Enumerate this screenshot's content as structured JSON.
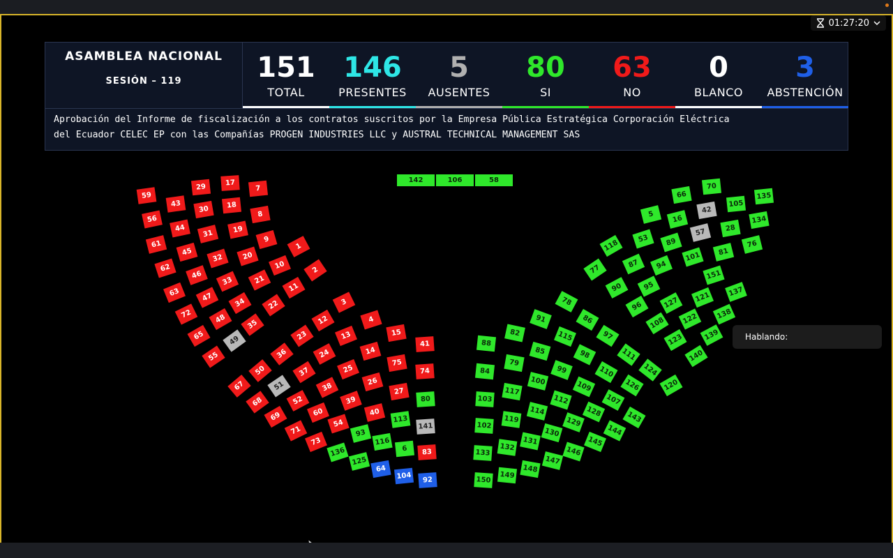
{
  "timer": {
    "time": "01:27:20"
  },
  "header": {
    "title": "ASAMBLEA NACIONAL",
    "session": "SESIÓN – 119"
  },
  "stats": [
    {
      "value": "151",
      "label": "TOTAL",
      "color": "#ffffff"
    },
    {
      "value": "146",
      "label": "PRESENTES",
      "color": "#2ee6e6"
    },
    {
      "value": "5",
      "label": "AUSENTES",
      "color": "#b0b0b0"
    },
    {
      "value": "80",
      "label": "SI",
      "color": "#2fe82b"
    },
    {
      "value": "63",
      "label": "NO",
      "color": "#f01a1a"
    },
    {
      "value": "0",
      "label": "BLANCO",
      "color": "#ffffff"
    },
    {
      "value": "3",
      "label": "ABSTENCIÓN",
      "color": "#1f5fe8"
    }
  ],
  "description": {
    "line1": "Aprobación del Informe de fiscalización a los contratos suscritos por la Empresa Pública Estratégica Corporación Eléctrica",
    "line2": "del Ecuador CELEC EP con las Compañías PROGEN INDUSTRIES LLC y AUSTRAL TECHNICAL MANAGEMENT SAS"
  },
  "speaking": {
    "label": "Hablando:"
  },
  "vote_colors": {
    "si": "#2fe82b",
    "no": "#f01a1a",
    "abstencion": "#1f5fe8",
    "ausente": "#b9b9b9"
  },
  "seats_top": [
    {
      "n": "142",
      "v": "si"
    },
    {
      "n": "106",
      "v": "si"
    },
    {
      "n": "58",
      "v": "si"
    }
  ],
  "seats_left": [
    {
      "n": "59",
      "v": "no"
    },
    {
      "n": "56",
      "v": "no"
    },
    {
      "n": "61",
      "v": "no"
    },
    {
      "n": "62",
      "v": "no"
    },
    {
      "n": "63",
      "v": "no"
    },
    {
      "n": "72",
      "v": "no"
    },
    {
      "n": "65",
      "v": "no"
    },
    {
      "n": "55",
      "v": "no"
    },
    {
      "n": "43",
      "v": "no"
    },
    {
      "n": "44",
      "v": "no"
    },
    {
      "n": "45",
      "v": "no"
    },
    {
      "n": "46",
      "v": "no"
    },
    {
      "n": "47",
      "v": "no"
    },
    {
      "n": "48",
      "v": "no"
    },
    {
      "n": "49",
      "v": "au"
    },
    {
      "n": "29",
      "v": "no"
    },
    {
      "n": "30",
      "v": "no"
    },
    {
      "n": "31",
      "v": "no"
    },
    {
      "n": "32",
      "v": "no"
    },
    {
      "n": "33",
      "v": "no"
    },
    {
      "n": "34",
      "v": "no"
    },
    {
      "n": "35",
      "v": "no"
    },
    {
      "n": "17",
      "v": "no"
    },
    {
      "n": "18",
      "v": "no"
    },
    {
      "n": "19",
      "v": "no"
    },
    {
      "n": "20",
      "v": "no"
    },
    {
      "n": "21",
      "v": "no"
    },
    {
      "n": "22",
      "v": "no"
    },
    {
      "n": "7",
      "v": "no"
    },
    {
      "n": "8",
      "v": "no"
    },
    {
      "n": "9",
      "v": "no"
    },
    {
      "n": "10",
      "v": "no"
    },
    {
      "n": "11",
      "v": "no"
    },
    {
      "n": "1",
      "v": "no"
    },
    {
      "n": "2",
      "v": "no"
    },
    {
      "n": "3",
      "v": "no"
    },
    {
      "n": "4",
      "v": "no"
    },
    {
      "n": "15",
      "v": "no"
    },
    {
      "n": "41",
      "v": "no"
    },
    {
      "n": "12",
      "v": "no"
    },
    {
      "n": "13",
      "v": "no"
    },
    {
      "n": "14",
      "v": "no"
    },
    {
      "n": "75",
      "v": "no"
    },
    {
      "n": "74",
      "v": "no"
    },
    {
      "n": "23",
      "v": "no"
    },
    {
      "n": "24",
      "v": "no"
    },
    {
      "n": "25",
      "v": "no"
    },
    {
      "n": "26",
      "v": "no"
    },
    {
      "n": "27",
      "v": "no"
    },
    {
      "n": "80",
      "v": "si"
    },
    {
      "n": "36",
      "v": "no"
    },
    {
      "n": "37",
      "v": "no"
    },
    {
      "n": "38",
      "v": "no"
    },
    {
      "n": "39",
      "v": "no"
    },
    {
      "n": "40",
      "v": "no"
    },
    {
      "n": "113",
      "v": "si"
    },
    {
      "n": "141",
      "v": "au"
    },
    {
      "n": "50",
      "v": "no"
    },
    {
      "n": "51",
      "v": "au"
    },
    {
      "n": "52",
      "v": "no"
    },
    {
      "n": "60",
      "v": "no"
    },
    {
      "n": "54",
      "v": "no"
    },
    {
      "n": "93",
      "v": "si"
    },
    {
      "n": "116",
      "v": "si"
    },
    {
      "n": "6",
      "v": "si"
    },
    {
      "n": "83",
      "v": "no"
    },
    {
      "n": "67",
      "v": "no"
    },
    {
      "n": "68",
      "v": "no"
    },
    {
      "n": "69",
      "v": "no"
    },
    {
      "n": "71",
      "v": "no"
    },
    {
      "n": "73",
      "v": "no"
    },
    {
      "n": "136",
      "v": "si"
    },
    {
      "n": "125",
      "v": "si"
    },
    {
      "n": "64",
      "v": "ab"
    },
    {
      "n": "104",
      "v": "ab"
    },
    {
      "n": "92",
      "v": "ab"
    }
  ],
  "seats_right": [
    {
      "n": "88",
      "v": "si"
    },
    {
      "n": "82",
      "v": "si"
    },
    {
      "n": "91",
      "v": "si"
    },
    {
      "n": "78",
      "v": "si"
    },
    {
      "n": "84",
      "v": "si"
    },
    {
      "n": "79",
      "v": "si"
    },
    {
      "n": "85",
      "v": "si"
    },
    {
      "n": "115",
      "v": "si"
    },
    {
      "n": "86",
      "v": "si"
    },
    {
      "n": "103",
      "v": "si"
    },
    {
      "n": "117",
      "v": "si"
    },
    {
      "n": "100",
      "v": "si"
    },
    {
      "n": "99",
      "v": "si"
    },
    {
      "n": "98",
      "v": "si"
    },
    {
      "n": "97",
      "v": "si"
    },
    {
      "n": "102",
      "v": "si"
    },
    {
      "n": "119",
      "v": "si"
    },
    {
      "n": "114",
      "v": "si"
    },
    {
      "n": "112",
      "v": "si"
    },
    {
      "n": "109",
      "v": "si"
    },
    {
      "n": "110",
      "v": "si"
    },
    {
      "n": "111",
      "v": "si"
    },
    {
      "n": "133",
      "v": "si"
    },
    {
      "n": "132",
      "v": "si"
    },
    {
      "n": "131",
      "v": "si"
    },
    {
      "n": "130",
      "v": "si"
    },
    {
      "n": "129",
      "v": "si"
    },
    {
      "n": "128",
      "v": "si"
    },
    {
      "n": "107",
      "v": "si"
    },
    {
      "n": "126",
      "v": "si"
    },
    {
      "n": "124",
      "v": "si"
    },
    {
      "n": "150",
      "v": "si"
    },
    {
      "n": "149",
      "v": "si"
    },
    {
      "n": "148",
      "v": "si"
    },
    {
      "n": "147",
      "v": "si"
    },
    {
      "n": "146",
      "v": "si"
    },
    {
      "n": "145",
      "v": "si"
    },
    {
      "n": "144",
      "v": "si"
    },
    {
      "n": "143",
      "v": "si"
    },
    {
      "n": "118",
      "v": "si"
    },
    {
      "n": "77",
      "v": "si"
    },
    {
      "n": "5",
      "v": "si"
    },
    {
      "n": "53",
      "v": "si"
    },
    {
      "n": "87",
      "v": "si"
    },
    {
      "n": "90",
      "v": "si"
    },
    {
      "n": "66",
      "v": "si"
    },
    {
      "n": "16",
      "v": "si"
    },
    {
      "n": "89",
      "v": "si"
    },
    {
      "n": "94",
      "v": "si"
    },
    {
      "n": "95",
      "v": "si"
    },
    {
      "n": "96",
      "v": "si"
    },
    {
      "n": "70",
      "v": "si"
    },
    {
      "n": "42",
      "v": "au"
    },
    {
      "n": "57",
      "v": "au"
    },
    {
      "n": "101",
      "v": "si"
    },
    {
      "n": "127",
      "v": "si"
    },
    {
      "n": "108",
      "v": "si"
    },
    {
      "n": "105",
      "v": "si"
    },
    {
      "n": "28",
      "v": "si"
    },
    {
      "n": "81",
      "v": "si"
    },
    {
      "n": "151",
      "v": "si"
    },
    {
      "n": "121",
      "v": "si"
    },
    {
      "n": "122",
      "v": "si"
    },
    {
      "n": "123",
      "v": "si"
    },
    {
      "n": "135",
      "v": "si"
    },
    {
      "n": "134",
      "v": "si"
    },
    {
      "n": "76",
      "v": "si"
    },
    {
      "n": "137",
      "v": "si"
    },
    {
      "n": "138",
      "v": "si"
    },
    {
      "n": "139",
      "v": "si"
    },
    {
      "n": "140",
      "v": "si"
    },
    {
      "n": "120",
      "v": "si"
    }
  ]
}
